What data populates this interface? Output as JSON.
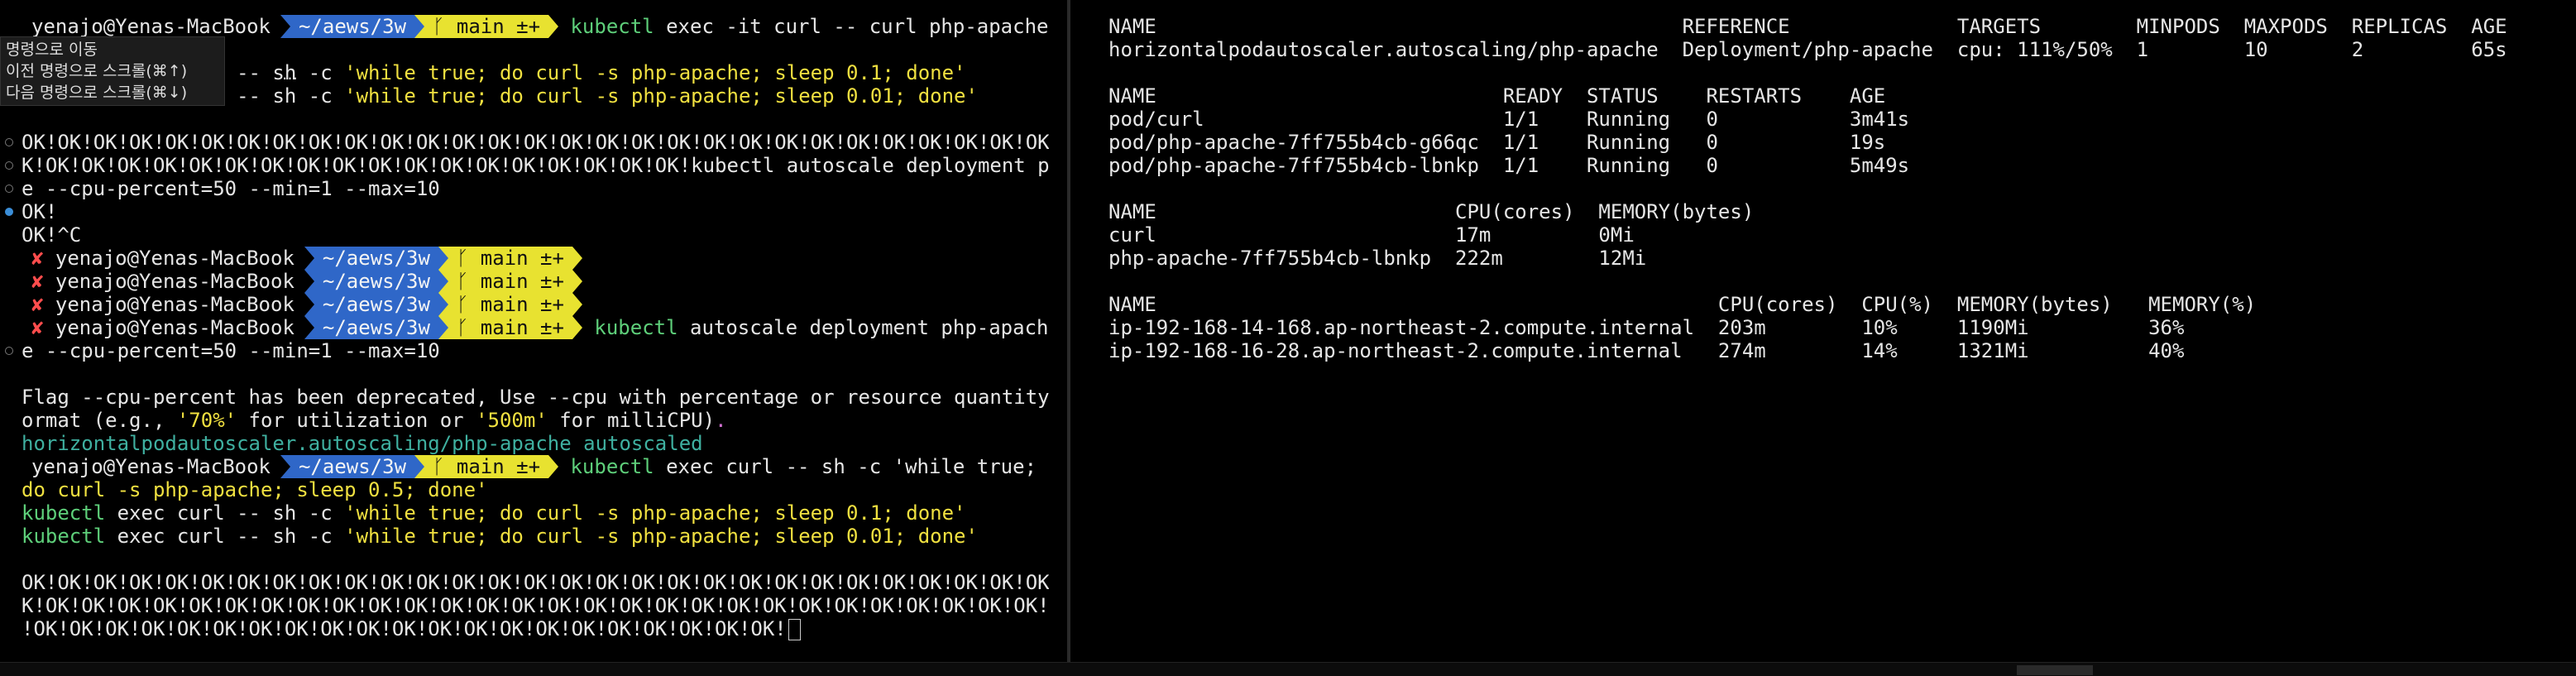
{
  "left_pane": {
    "tooltip": {
      "items": [
        "명령으로 이동",
        "이전 명령으로 스크롤(⌘↑)",
        "다음 명령으로 스크롤(⌘↓)"
      ],
      "overflow": "…"
    },
    "prompt": {
      "user": "yenajo@Yenas-MacBook",
      "path": "~/aews/3w",
      "git": "ᚴ main ±+"
    },
    "lines": [
      {
        "type": "prompt",
        "cmd": "kubectl exec -it curl -- curl php-apache"
      },
      {
        "type": "text",
        "text": "OK!"
      },
      {
        "type": "split",
        "parts": [
          [
            "plain",
            "kubectl exec curl -- sh -c "
          ],
          [
            "yellow",
            "'while true; do curl -s php-apache; sleep 0.1; done'"
          ]
        ]
      },
      {
        "type": "split",
        "parts": [
          [
            "green",
            "kubectl"
          ],
          [
            "plain",
            " exec curl -- sh -c "
          ],
          [
            "yellow",
            "'while true; do curl -s php-apache; sleep 0.01; done'"
          ]
        ]
      },
      {
        "type": "blank"
      },
      {
        "type": "text",
        "dot": "hollow",
        "text": "OK!OK!OK!OK!OK!OK!OK!OK!OK!OK!OK!OK!OK!OK!OK!OK!OK!OK!OK!OK!OK!OK!OK!OK!OK!OK!OK!OK!OK!O"
      },
      {
        "type": "text",
        "dot": "hollow",
        "text": "K!OK!OK!OK!OK!OK!OK!OK!OK!OK!OK!OK!OK!OK!OK!OK!OK!OK!OK!kubectl autoscale deployment php-apach"
      },
      {
        "type": "text",
        "dot": "hollow",
        "text": "e --cpu-percent=50 --min=1 --max=10"
      },
      {
        "type": "text",
        "dot": "filled",
        "text": "OK!"
      },
      {
        "type": "text",
        "text": "OK!^C"
      },
      {
        "type": "errprompt",
        "cmd": ""
      },
      {
        "type": "errprompt",
        "cmd": ""
      },
      {
        "type": "errprompt",
        "cmd": ""
      },
      {
        "type": "errprompt",
        "cmd": "kubectl autoscale deployment php-apach"
      },
      {
        "type": "text",
        "dot": "hollow",
        "text": "e --cpu-percent=50 --min=1 --max=10"
      },
      {
        "type": "blank"
      },
      {
        "type": "text",
        "text": "Flag --cpu-percent has been deprecated, Use --cpu with percentage or resource quantity f"
      },
      {
        "type": "split",
        "parts": [
          [
            "plain",
            "ormat (e.g., "
          ],
          [
            "yellow",
            "'70%'"
          ],
          [
            "plain",
            " for utilization or "
          ],
          [
            "yellow",
            "'500m'"
          ],
          [
            "plain",
            " for milliCPU)"
          ],
          [
            "magenta",
            "."
          ]
        ]
      },
      {
        "type": "split",
        "parts": [
          [
            "gstatus",
            "horizontalpodautoscaler.autoscaling/php-apache autoscaled"
          ]
        ]
      },
      {
        "type": "prompt",
        "cmd": "kubectl exec curl -- sh -c 'while true;"
      },
      {
        "type": "split",
        "parts": [
          [
            "yellow",
            "do curl -s php-apache; sleep 0.5; done'"
          ]
        ]
      },
      {
        "type": "split",
        "parts": [
          [
            "green",
            "kubectl"
          ],
          [
            "plain",
            " exec curl -- sh -c "
          ],
          [
            "yellow",
            "'while true; do curl -s php-apache; sleep 0.1; done'"
          ]
        ]
      },
      {
        "type": "split",
        "parts": [
          [
            "green",
            "kubectl"
          ],
          [
            "plain",
            " exec curl -- sh -c "
          ],
          [
            "yellow",
            "'while true; do curl -s php-apache; sleep 0.01; done'"
          ]
        ]
      },
      {
        "type": "blank"
      },
      {
        "type": "text",
        "text": "OK!OK!OK!OK!OK!OK!OK!OK!OK!OK!OK!OK!OK!OK!OK!OK!OK!OK!OK!OK!OK!OK!OK!OK!OK!OK!OK!OK!OK!O"
      },
      {
        "type": "text",
        "text": "K!OK!OK!OK!OK!OK!OK!OK!OK!OK!OK!OK!OK!OK!OK!OK!OK!OK!OK!OK!OK!OK!OK!OK!OK!OK!OK!OK!OK!OK!"
      },
      {
        "type": "text",
        "text": "!OK!OK!OK!OK!OK!OK!OK!OK!OK!OK!OK!OK!OK!OK!OK!OK!OK!OK!OK!OK!OK!",
        "cursor": true
      }
    ]
  },
  "right_pane": {
    "hpa": {
      "headers": [
        "NAME",
        "REFERENCE",
        "TARGETS",
        "MINPODS",
        "MAXPODS",
        "REPLICAS",
        "AGE"
      ],
      "rows": [
        [
          "horizontalpodautoscaler.autoscaling/php-apache",
          "Deployment/php-apache",
          "cpu: 111%/50%",
          "1",
          "10",
          "2",
          "65s"
        ]
      ]
    },
    "pods": {
      "headers": [
        "NAME",
        "READY",
        "STATUS",
        "RESTARTS",
        "AGE"
      ],
      "rows": [
        [
          "pod/curl",
          "1/1",
          "Running",
          "0",
          "3m41s"
        ],
        [
          "pod/php-apache-7ff755b4cb-g66qc",
          "1/1",
          "Running",
          "0",
          "19s"
        ],
        [
          "pod/php-apache-7ff755b4cb-lbnkp",
          "1/1",
          "Running",
          "0",
          "5m49s"
        ]
      ]
    },
    "top_pods": {
      "headers": [
        "NAME",
        "CPU(cores)",
        "MEMORY(bytes)"
      ],
      "rows": [
        [
          "curl",
          "17m",
          "0Mi"
        ],
        [
          "php-apache-7ff755b4cb-lbnkp",
          "222m",
          "12Mi"
        ]
      ]
    },
    "top_nodes": {
      "headers": [
        "NAME",
        "CPU(cores)",
        "CPU(%)",
        "MEMORY(bytes)",
        "MEMORY(%)"
      ],
      "rows": [
        [
          "ip-192-168-14-168.ap-northeast-2.compute.internal",
          "203m",
          "10%",
          "1190Mi",
          "36%"
        ],
        [
          "ip-192-168-16-28.ap-northeast-2.compute.internal",
          "274m",
          "14%",
          "1321Mi",
          "40%"
        ]
      ]
    }
  },
  "colors": {
    "background": "#000000",
    "prompt_path": "#2f67c8",
    "prompt_git": "#e8e230",
    "string_yellow": "#f0e040",
    "command_green": "#5ecf7a",
    "error_red": "#ff4d4d"
  }
}
